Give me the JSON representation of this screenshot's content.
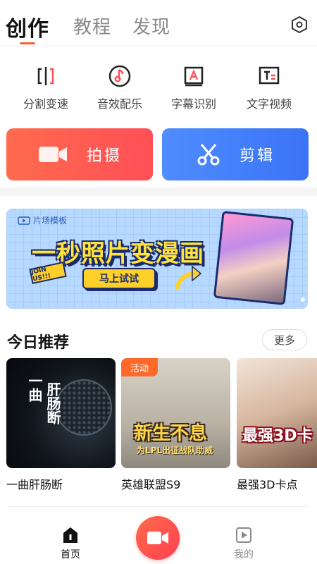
{
  "tabs": {
    "create": "创作",
    "tutorial": "教程",
    "discover": "发现"
  },
  "tools": [
    {
      "label": "分割变速",
      "icon": "split-speed-icon"
    },
    {
      "label": "音效配乐",
      "icon": "music-note-icon"
    },
    {
      "label": "字幕识别",
      "icon": "subtitle-a-icon"
    },
    {
      "label": "文字视频",
      "icon": "text-video-icon"
    }
  ],
  "actions": {
    "shoot": "拍摄",
    "edit": "剪辑"
  },
  "banner": {
    "tag": "片场模板",
    "title": "一秒照片变漫画",
    "cta": "马上试试",
    "badge": "JOIN US!!!"
  },
  "recommend": {
    "title": "今日推荐",
    "more": "更多",
    "items": [
      {
        "title": "一曲肝肠断",
        "cover_text_a": "一曲",
        "cover_text_b": "肝肠断"
      },
      {
        "title": "英雄联盟S9",
        "tag": "活动",
        "cover_text": "新生不息",
        "cover_sub": "为LPL出征战队助威"
      },
      {
        "title": "最强3D卡点",
        "cover_text": "最强3D卡"
      }
    ]
  },
  "nav": {
    "home": "首页",
    "mine": "我的"
  },
  "colors": {
    "accent_red": "#ff5a3c",
    "accent_blue": "#3a74f5"
  }
}
